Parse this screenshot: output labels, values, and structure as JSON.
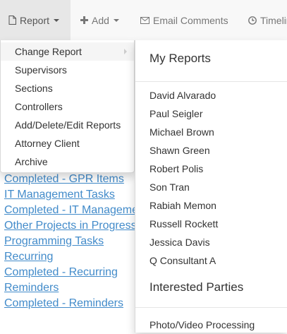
{
  "navbar": {
    "report_label": "Report",
    "add_label": "Add",
    "email_label": "Email Comments",
    "timeline_label": "Timeline",
    "icons": {
      "report": "file-icon",
      "add": "plus-icon",
      "email": "envelope-icon",
      "timeline": "clock-icon"
    }
  },
  "report_menu": {
    "items": [
      {
        "label": "Change Report"
      },
      {
        "label": "Supervisors"
      },
      {
        "label": "Sections"
      },
      {
        "label": "Controllers"
      },
      {
        "label": "Add/Delete/Edit Reports"
      },
      {
        "label": "Attorney Client"
      },
      {
        "label": "Archive"
      }
    ]
  },
  "change_report_submenu": {
    "my_reports_header": "My Reports",
    "my_reports": [
      "David Alvarado",
      "Paul Seigler",
      "Michael Brown",
      "Shawn Green",
      "Robert Polis",
      "Son Tran",
      "Rabiah Memon",
      "Russell Rockett",
      "Jessica Davis",
      "Q Consultant A"
    ],
    "interested_parties_header": "Interested Parties",
    "interested_parties": [
      "Photo/Video Processing"
    ]
  },
  "background_links": [
    "Completed - GPR Items",
    "IT Management Tasks",
    "Completed - IT Management",
    "Other Projects in Progress",
    "Programming Tasks",
    "Recurring",
    "Completed - Recurring",
    "Reminders",
    "Completed - Reminders"
  ],
  "colors": {
    "link": "#428bca",
    "navbar_bg": "#f8f8f8",
    "navbar_active_bg": "#e7e7e7",
    "hover_bg": "#f5f5f5"
  }
}
